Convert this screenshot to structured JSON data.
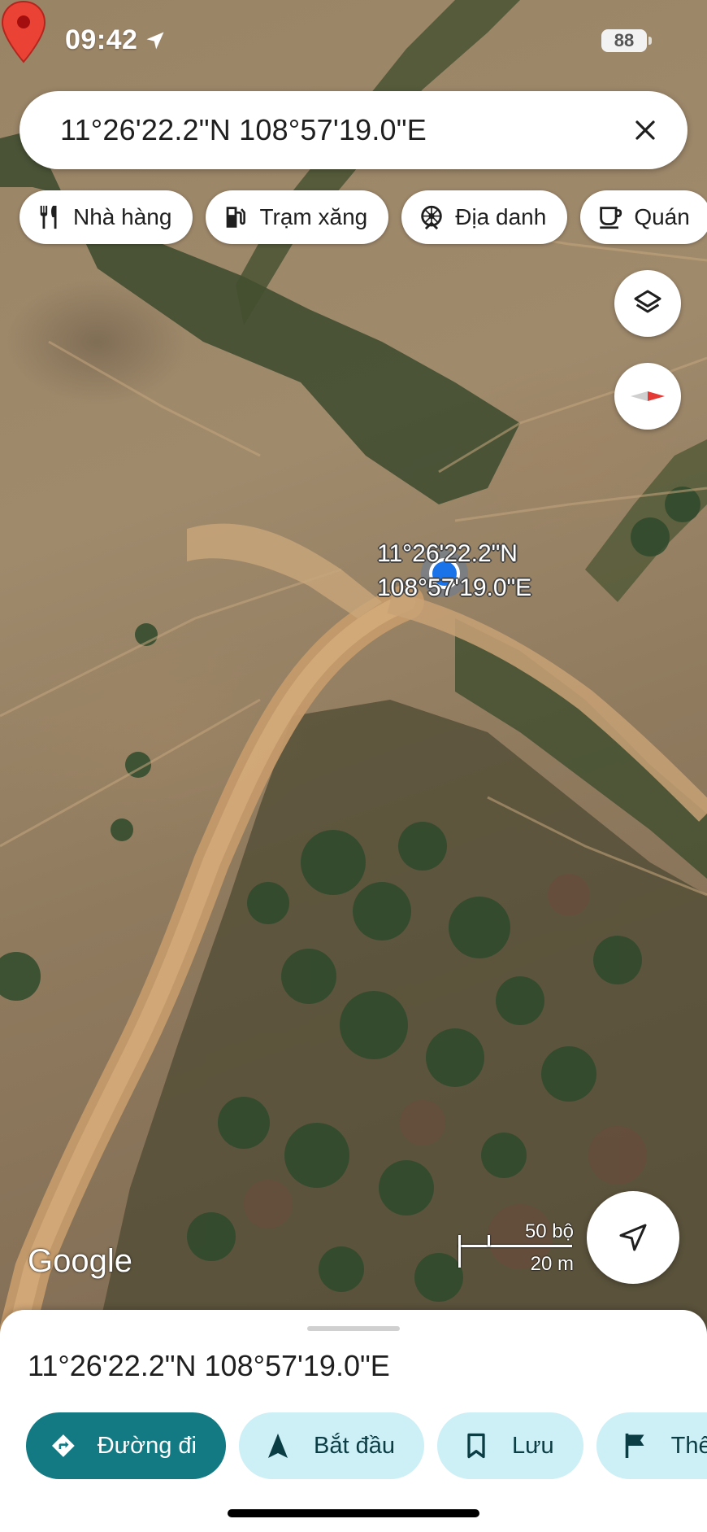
{
  "status_bar": {
    "time": "09:42",
    "battery": "88",
    "location_icon": "location-arrow-icon"
  },
  "search": {
    "query": "11°26'22.2\"N 108°57'19.0\"E",
    "close_icon": "close-icon"
  },
  "chips": [
    {
      "label": "Nhà hàng",
      "icon": "restaurant-icon"
    },
    {
      "label": "Trạm xăng",
      "icon": "gas-station-icon"
    },
    {
      "label": "Địa danh",
      "icon": "landmark-icon"
    },
    {
      "label": "Quán",
      "icon": "coffee-icon"
    }
  ],
  "map": {
    "pin_label_line1": "11°26'22.2\"N",
    "pin_label_line2": "108°57'19.0\"E",
    "attribution": "Google",
    "scale_imperial": "50 bộ",
    "scale_metric": "20 m",
    "layers_icon": "layers-icon",
    "compass_icon": "compass-icon",
    "locate_icon": "navigation-arrow-icon"
  },
  "sheet": {
    "title": "11°26'22.2\"N 108°57'19.0\"E",
    "actions": [
      {
        "label": "Đường đi",
        "icon": "directions-icon"
      },
      {
        "label": "Bắt đầu",
        "icon": "navigate-start-icon"
      },
      {
        "label": "Lưu",
        "icon": "bookmark-icon"
      },
      {
        "label": "Thêm",
        "icon": "flag-icon"
      }
    ]
  },
  "colors": {
    "primary_action": "#137a83",
    "secondary_action": "#cdeff6",
    "pin_red": "#ea4335",
    "location_blue": "#1a73e8"
  }
}
